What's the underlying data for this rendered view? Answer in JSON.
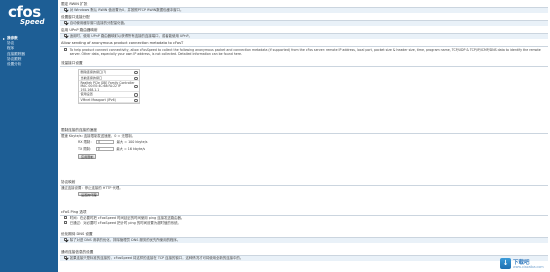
{
  "app": {
    "logo_main": "cfos",
    "logo_sub": "Speed"
  },
  "sidebar": {
    "items": [
      {
        "label": "我参数",
        "active": true
      },
      {
        "label": "协议",
        "active": false
      },
      {
        "label": "程序",
        "active": false
      },
      {
        "label": "连接跟踪器",
        "active": false
      },
      {
        "label": "协议跟踪",
        "active": false
      },
      {
        "label": "设置分析",
        "active": false
      }
    ]
  },
  "sections": {
    "rwin": {
      "title": "限定 RWIN 扩张",
      "opt1": "对 Windows 默认 RWIN 值设置为0，并按照PTCP RWIN数据包缓冲窗口。"
    },
    "traffic": {
      "title": "设置窗口连接分配",
      "opt1": "自动使用缓存窗口连接的分配量化值。"
    },
    "upnp": {
      "title": "启用 UPnP 路由器映射",
      "opt1": "适用时，使用 UPnP 路由器映射以获得所有连接的连接端口，或者能使用 UPnP。"
    },
    "anon": {
      "title": "Allow sending of anonymous product connection metadata to cFosT",
      "opt1": "To help product connect connectivity, allow cFosSpeed to collect the following anonymous packet and connection metadata (if supported) from the cFos server: remote IP address, local port, packet size & header size, time, program name, TCP/UDP & TCP/IP/ICMP/DNS data to identify the remote server. Other data, especially your own IP address, is not collected. Detailed information can be found here."
    },
    "iface": {
      "title": "流量接口设置",
      "rows": [
        "删除连接的接口(?)",
        "当前连接的接口",
        "Realtek PCIe GBE Family Controller\nMAC 00:E0:4C:68:FA:22 IP 192.168.1.1",
        "使用设置",
        "VMnet Masqport (IPv6)"
      ]
    },
    "limits": {
      "title": "限制连接的连接的速度",
      "desc": "限速 Kbyte/s: 连接限制发送速度，0 = 无限制。",
      "rx_label": "RX 限制：",
      "rx_value": "0",
      "rx_hint": "最大 = 100 kbyte/s",
      "tx_label": "TX 限制：",
      "tx_value": "0",
      "tx_hint": "最大 = 16 kbyte/s",
      "apply_button": "应用限制"
    },
    "proxy": {
      "title": "协议映射",
      "desc": "通过连接设置：停止连接的 HTTP 代理。",
      "button": "设置的代理"
    },
    "ping": {
      "title": "cFoS Ping 选项",
      "opt1": "时间：在必要时把 cFosSpeed 时间延迟的时间使用 ping 连接发送路由器。",
      "opt2": "已通过：对必要时 cFosSpeed 把计时 ping 的时间设置为超时值的系统。"
    },
    "dns": {
      "title": "优化期待 DNS 设置",
      "opt1": "除了对进 DNS 请求的优化，排除管理员 DNS 服务的优先所使用的程序。"
    },
    "tcp": {
      "title": "通讯连接信息的设置",
      "opt1": "如果连接只是标准的连接的，cFosSpeed 将这样的连接在 TCP 连接的窗口，这种情况才可将使用全新的连接中的。"
    }
  },
  "watermark": {
    "title": "下载吧",
    "url": "www.xiazaiba.com"
  }
}
